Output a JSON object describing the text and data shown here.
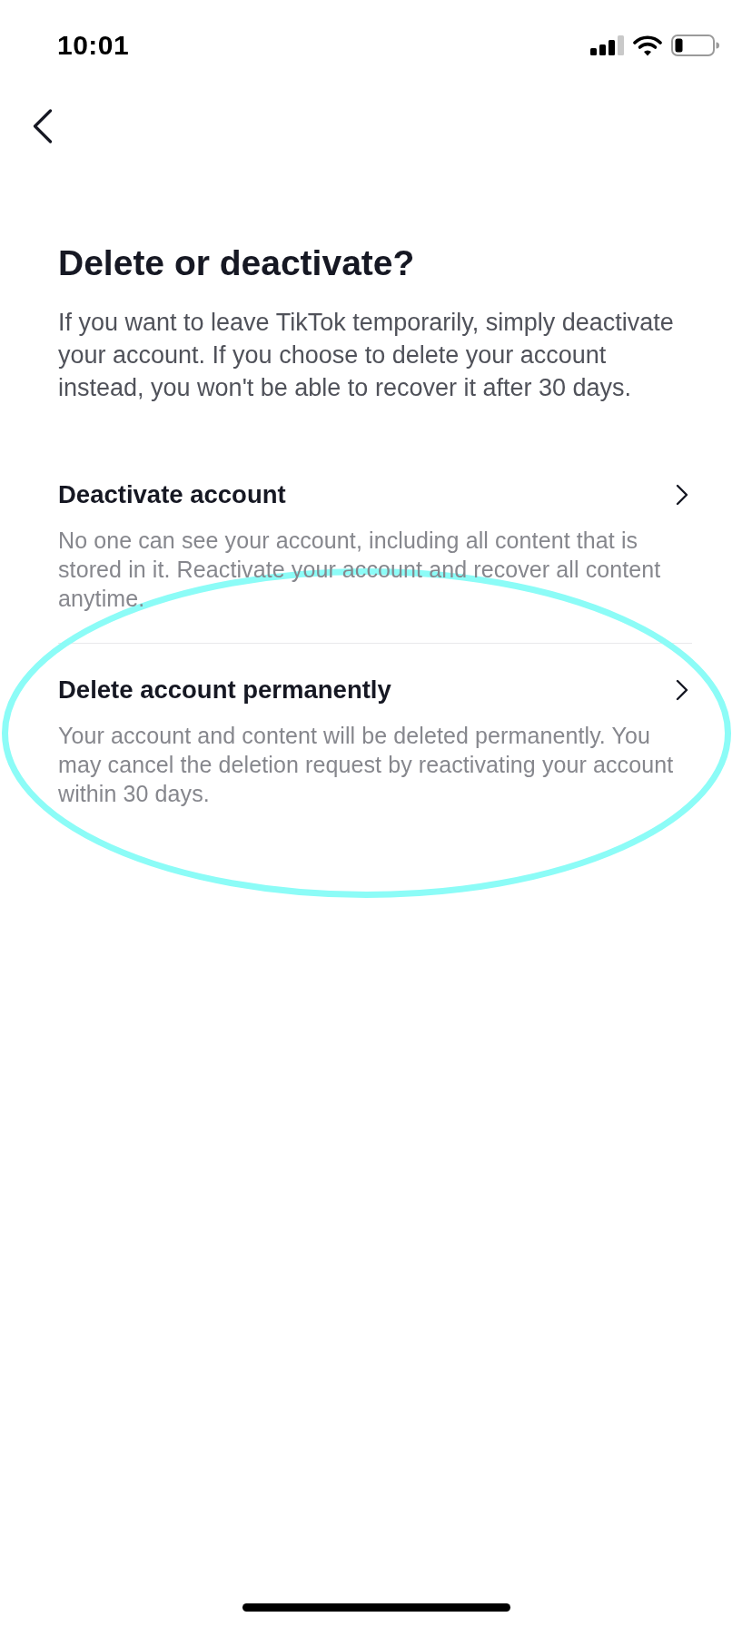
{
  "status_bar": {
    "time": "10:01"
  },
  "title": "Delete or deactivate?",
  "intro": "If you want to leave TikTok temporarily, simply deactivate your account. If you choose to delete your account instead, you won't be able to recover it after 30 days.",
  "options": [
    {
      "title": "Deactivate account",
      "description": "No one can see your account, including all content that is stored in it. Reactivate your account and recover all content anytime.",
      "highlighted": false
    },
    {
      "title": "Delete account permanently",
      "description": "Your account and content will be deleted permanently. You may cancel the deletion request by reactivating your account within 30 days.",
      "highlighted": true
    }
  ]
}
